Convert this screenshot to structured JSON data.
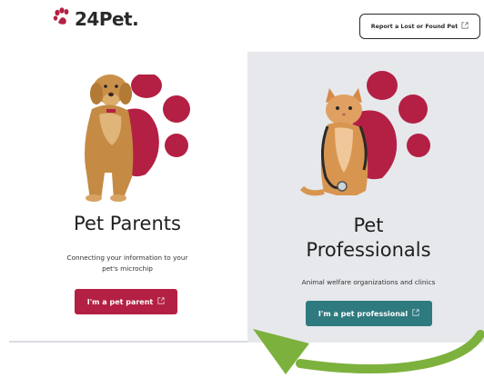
{
  "header": {
    "logo_text": "24Pet.",
    "report_button_label": "Report a Lost or Found Pet"
  },
  "parents": {
    "title": "Pet Parents",
    "subtitle_line1": "Connecting your information to your",
    "subtitle_line2": "pet's microchip",
    "cta_label": "I'm a pet parent"
  },
  "professionals": {
    "title_line1": "Pet",
    "title_line2": "Professionals",
    "subtitle": "Animal welfare organizations and clinics",
    "cta_label": "I'm a pet professional"
  },
  "colors": {
    "brand_red": "#b32043",
    "teal": "#2f7a7e",
    "panel_gray": "#e6e8ec",
    "arrow_green": "#7db13d"
  },
  "icons": [
    "paw-logo-icon",
    "external-link-icon",
    "paw-print-icon",
    "dog-image",
    "cat-image",
    "green-arrow-icon"
  ]
}
